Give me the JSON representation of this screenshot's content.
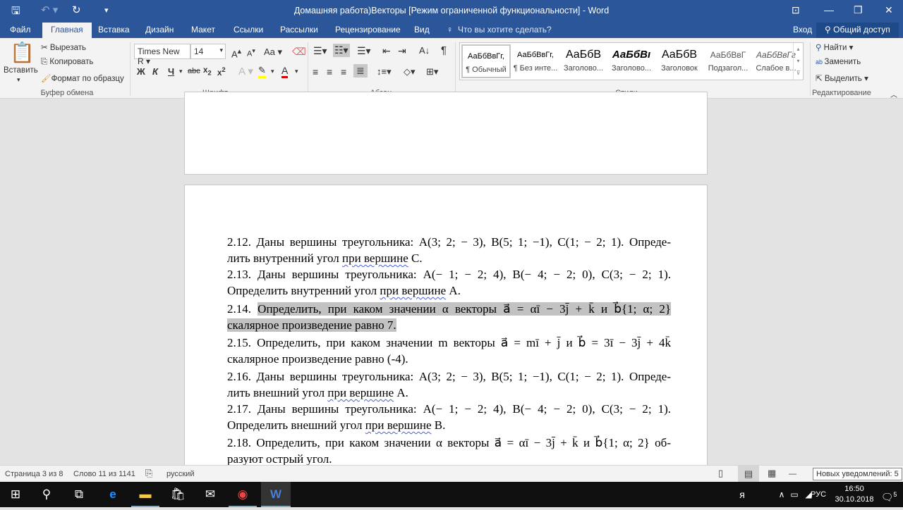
{
  "window": {
    "title": "Домашняя работа)Векторы [Режим ограниченной функциональности] - Word"
  },
  "tabs": [
    "Файл",
    "Главная",
    "Вставка",
    "Дизайн",
    "Макет",
    "Ссылки",
    "Рассылки",
    "Рецензирование",
    "Вид"
  ],
  "tell_me": "Что вы хотите сделать?",
  "signin": "Вход",
  "share": "Общий доступ",
  "clipboard": {
    "paste": "Вставить",
    "cut": "Вырезать",
    "copy": "Копировать",
    "format_painter": "Формат по образцу",
    "group": "Буфер обмена"
  },
  "font": {
    "name": "Times New R",
    "size": "14",
    "group": "Шрифт",
    "bold": "Ж",
    "italic": "К",
    "underline": "Ч",
    "case": "Aa"
  },
  "paragraph": {
    "group": "Абзац"
  },
  "styles": {
    "group": "Стили",
    "items": [
      {
        "preview": "АаБбВвГг,",
        "name": "¶ Обычный"
      },
      {
        "preview": "АаБбВвГг,",
        "name": "¶ Без инте..."
      },
      {
        "preview": "АаБбВ",
        "name": "Заголово..."
      },
      {
        "preview": "АаБбВı",
        "name": "Заголово..."
      },
      {
        "preview": "АаБбВ",
        "name": "Заголовок"
      },
      {
        "preview": "АаБбВвГ",
        "name": "Подзагол..."
      },
      {
        "preview": "АаБбВвГг",
        "name": "Слабое в..."
      }
    ]
  },
  "editing": {
    "find": "Найти",
    "replace": "Заменить",
    "select": "Выделить",
    "group": "Редактирование"
  },
  "doc": {
    "lines": [
      {
        "pre": "2.12. Даны вершины треугольника: A(3; 2; − 3), B(5; 1; −1), C(1; − 2; 1). Опреде-"
      },
      {
        "pre": "лить внутренний угол ",
        "sq": "при вершине",
        "post": " C.",
        "last": true
      },
      {
        "pre": "2.13. Даны вершины треугольника: A(− 1; − 2; 4), B(− 4; − 2; 0), C(3; − 2; 1)."
      },
      {
        "pre": "Определить внутренний угол ",
        "sq": "при вершине",
        "post": " A.",
        "last": true
      },
      {
        "pre": "2.14. ",
        "hl": "Определить, при каком значении α векторы a⃗ = αī − 3j̄ + k̄ и b⃗{1; α; 2}"
      },
      {
        "hl": "скалярное произведение равно 7. ",
        "last": true
      },
      {
        "pre": "2.15. Определить, при каком значении m векторы a⃗ = mī + j̄ и b⃗ = 3ī − 3j̄ + 4k̄"
      },
      {
        "pre": "скалярное произведение равно (-4).",
        "last": true
      },
      {
        "pre": "2.16. Даны вершины треугольника: A(3; 2; − 3), B(5; 1; −1), C(1; − 2; 1). Опреде-"
      },
      {
        "pre": "лить внешний угол ",
        "sq": "при вершине",
        "post": " A.",
        "last": true
      },
      {
        "pre": "2.17. Даны вершины треугольника: A(− 1; − 2; 4), B(− 4; − 2; 0), C(3; − 2; 1)."
      },
      {
        "pre": "Определить внешний угол ",
        "sq": "при вершине",
        "post": " B.",
        "last": true
      },
      {
        "pre": "2.18. Определить, при каком значении α векторы a⃗ = αī − 3j̄ + k̄ и b⃗{1; α; 2} об-"
      },
      {
        "pre": "разуют острый угол.",
        "last": true
      }
    ]
  },
  "status": {
    "page": "Страница 3 из 8",
    "words": "Слово 11 из 1141",
    "lang": "русский",
    "notifications": "Новых уведомлений: 5"
  },
  "taskbar": {
    "lang": "РУС",
    "time": "16:50",
    "date": "30.10.2018",
    "badge": "5"
  }
}
